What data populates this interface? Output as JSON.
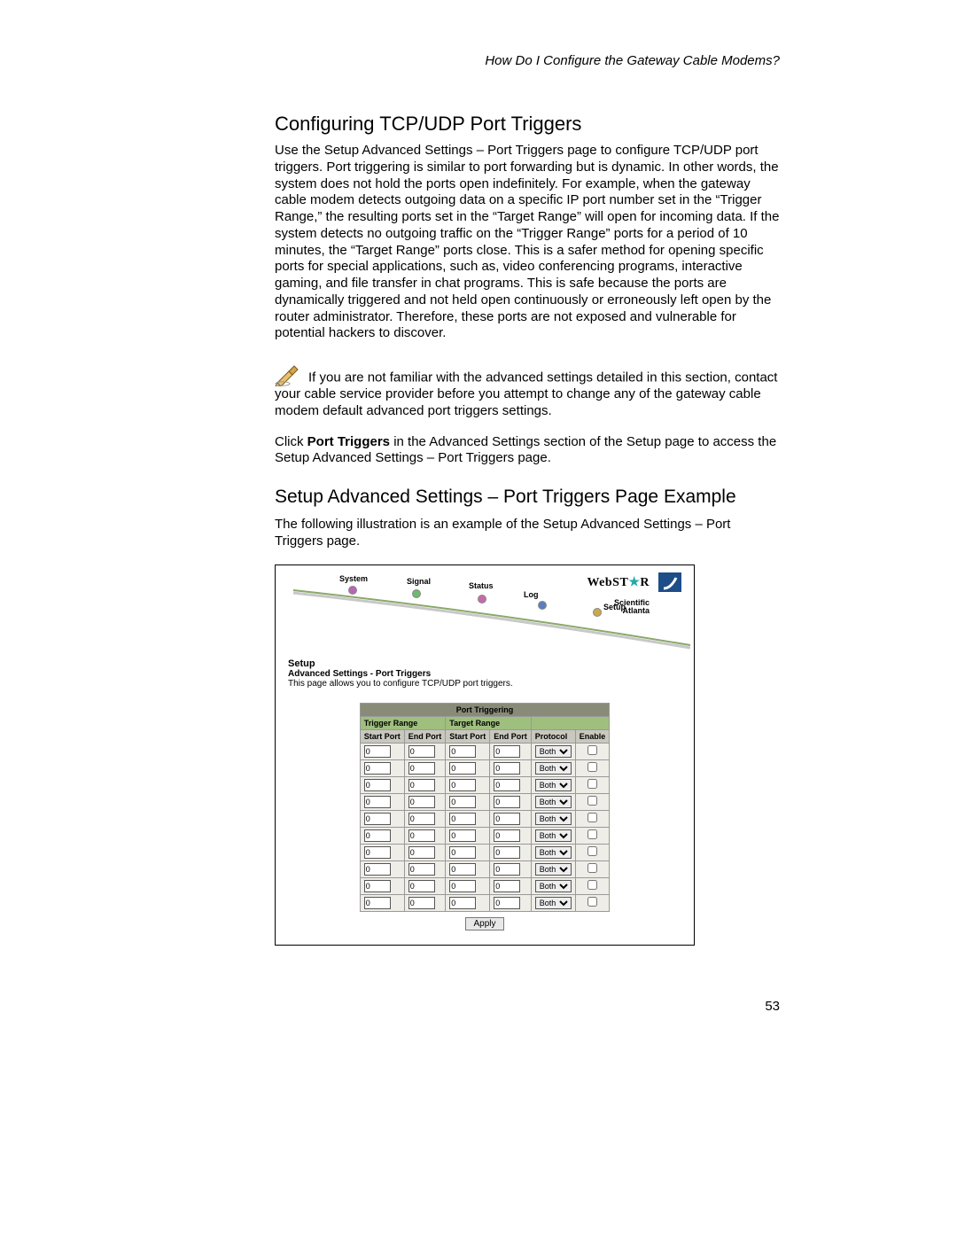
{
  "running_head": "How Do I Configure the Gateway Cable Modems?",
  "section_title": "Configuring TCP/UDP Port Triggers",
  "intro_paragraph": "Use the Setup Advanced Settings – Port Triggers page to configure TCP/UDP port triggers. Port triggering is similar to port forwarding but is dynamic. In other words, the system does not hold the ports open indefinitely. For example, when the gateway cable modem detects outgoing data on a specific IP port number set in the “Trigger Range,” the resulting ports set in the “Target Range” will open for incoming data. If the system detects no outgoing traffic on the “Trigger Range” ports for a period of 10 minutes, the “Target Range” ports close. This is a safer method for opening specific ports for special applications, such as, video conferencing programs, interactive gaming, and file transfer in chat programs. This is safe because the ports are dynamically triggered and not held open continuously or erroneously left open by the router administrator. Therefore, these ports are not exposed and vulnerable for potential hackers to discover.",
  "note_text": "If you are not familiar with the advanced settings detailed in this section, contact your cable service provider before you attempt to change any of the gateway cable modem default advanced port triggers settings.",
  "click_prefix": "Click ",
  "click_bold": "Port Triggers",
  "click_suffix": " in the Advanced Settings section of the Setup page to access the Setup Advanced Settings – Port Triggers page.",
  "sub_title": "Setup Advanced Settings – Port Triggers Page Example",
  "sub_intro": "The following illustration is an example of the Setup Advanced Settings – Port Triggers page.",
  "page_number": "53",
  "screenshot": {
    "nav": {
      "system": "System",
      "signal": "Signal",
      "status": "Status",
      "log": "Log",
      "setup": "Setup"
    },
    "brand": {
      "webstar": "WebST",
      "star": "★",
      "r": "R",
      "sci1": "Scientific",
      "sci2": "Atlanta"
    },
    "setup_title": "Setup",
    "setup_sub": "Advanced Settings - Port Triggers",
    "setup_desc": "This page allows you to configure TCP/UDP port triggers.",
    "table": {
      "main_header": "Port Triggering",
      "trigger_range": "Trigger Range",
      "target_range": "Target Range",
      "cols": {
        "start": "Start Port",
        "end": "End Port",
        "proto": "Protocol",
        "enable": "Enable"
      },
      "default_value": "0",
      "protocol_value": "Both",
      "row_count": 10,
      "apply": "Apply"
    }
  }
}
